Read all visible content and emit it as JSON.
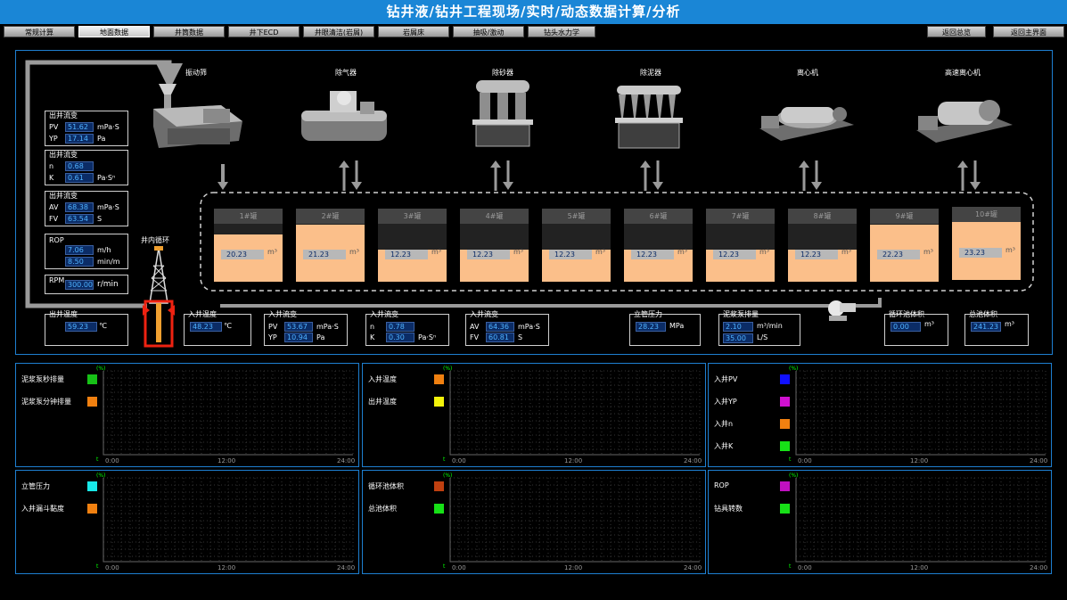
{
  "title": "钻井液/钻井工程现场/实时/动态数据计算/分析",
  "tabs": [
    {
      "label": "常规计算"
    },
    {
      "label": "地面数据"
    },
    {
      "label": "井筒数据"
    },
    {
      "label": "井下ECD"
    },
    {
      "label": "井眼清洁(岩屑)"
    },
    {
      "label": "岩屑床"
    },
    {
      "label": "抽吸/激动"
    },
    {
      "label": "钻头水力学"
    }
  ],
  "nav": {
    "back_overview": "返回总览",
    "back_main": "返回主界面"
  },
  "equipment": [
    {
      "name": "振动筛",
      "icon": "shaker-icon"
    },
    {
      "name": "除气器",
      "icon": "degasser-icon"
    },
    {
      "name": "除砂器",
      "icon": "desander-icon"
    },
    {
      "name": "除泥器",
      "icon": "desilter-icon"
    },
    {
      "name": "离心机",
      "icon": "centrifuge-icon"
    },
    {
      "name": "高速离心机",
      "icon": "high-speed-centrifuge-icon"
    }
  ],
  "tanks": [
    {
      "name": "1#罐",
      "volume": "20.23",
      "unit": "m³",
      "level": 0.82
    },
    {
      "name": "2#罐",
      "volume": "21.23",
      "unit": "m³",
      "level": 0.98
    },
    {
      "name": "3#罐",
      "volume": "12.23",
      "unit": "m³",
      "level": 0.55
    },
    {
      "name": "4#罐",
      "volume": "12.23",
      "unit": "m³",
      "level": 0.55
    },
    {
      "name": "5#罐",
      "volume": "12.23",
      "unit": "m³",
      "level": 0.55
    },
    {
      "name": "6#罐",
      "volume": "12.23",
      "unit": "m³",
      "level": 0.55
    },
    {
      "name": "7#罐",
      "volume": "12.23",
      "unit": "m³",
      "level": 0.55
    },
    {
      "name": "8#罐",
      "volume": "12.23",
      "unit": "m³",
      "level": 0.55
    },
    {
      "name": "9#罐",
      "volume": "22.23",
      "unit": "m³",
      "level": 0.98
    },
    {
      "name": "10#罐",
      "volume": "23.23",
      "unit": "m³",
      "level": 1.0
    }
  ],
  "left": {
    "rheo1": {
      "title": "出井流变",
      "pv_label": "PV",
      "pv": "51.62",
      "pv_unit": "mPa·S",
      "yp_label": "YP",
      "yp": "17.14",
      "yp_unit": "Pa"
    },
    "rheo2": {
      "title": "出井流变",
      "n_label": "n",
      "n": "0.68",
      "k_label": "K",
      "k": "0.61",
      "k_unit": "Pa·Sⁿ"
    },
    "rheo3": {
      "title": "出井流变",
      "av_label": "AV",
      "av": "68.38",
      "av_unit": "mPa·S",
      "fv_label": "FV",
      "fv": "63.54",
      "fv_unit": "S"
    },
    "rop": {
      "title": "ROP",
      "v1": "7.06",
      "u1": "m/h",
      "v2": "8.50",
      "u2": "min/m"
    },
    "rpm": {
      "label": "RPM",
      "value": "300.00",
      "unit": "r/min"
    },
    "well_label": "井内循环"
  },
  "bottom": {
    "out_temp": {
      "title": "出井温度",
      "value": "59.23",
      "unit": "℃"
    },
    "in_temp": {
      "title": "入井温度",
      "value": "48.23",
      "unit": "℃"
    },
    "in_rheo1": {
      "title": "入井流变",
      "pv_label": "PV",
      "pv": "53.67",
      "pv_unit": "mPa·S",
      "yp_label": "YP",
      "yp": "10.94",
      "yp_unit": "Pa"
    },
    "in_rheo2": {
      "title": "入井流变",
      "n_label": "n",
      "n": "0.78",
      "k_label": "K",
      "k": "0.30",
      "k_unit": "Pa·Sⁿ"
    },
    "in_rheo3": {
      "title": "入井流变",
      "av_label": "AV",
      "av": "64.36",
      "av_unit": "mPa·S",
      "fv_label": "FV",
      "fv": "60.81",
      "fv_unit": "S"
    },
    "standpipe": {
      "title": "立管压力",
      "value": "28.23",
      "unit": "MPa"
    },
    "pump": {
      "title": "泥浆泵排量",
      "v1": "2.10",
      "u1": "m³/min",
      "v2": "35.00",
      "u2": "L/S"
    },
    "circ_vol": {
      "title": "循环池体积",
      "value": "0.00",
      "unit": "m³"
    },
    "total_vol": {
      "title": "总池体积",
      "value": "241.23",
      "unit": "m³"
    }
  },
  "charts": [
    {
      "unit": "(%)",
      "legend": [
        {
          "label": "泥浆泵秒排量",
          "color": "#17c117"
        },
        {
          "label": "泥浆泵分钟排量",
          "color": "#f08010"
        }
      ],
      "ticks": [
        "0:00",
        "12:00",
        "24:00"
      ],
      "xlabel": "t"
    },
    {
      "unit": "(%)",
      "legend": [
        {
          "label": "入井温度",
          "color": "#f08010"
        },
        {
          "label": "出井温度",
          "color": "#f2f20a"
        }
      ],
      "ticks": [
        "0:00",
        "12:00",
        "24:00"
      ],
      "xlabel": "t"
    },
    {
      "unit": "(%)",
      "legend": [
        {
          "label": "入井PV",
          "color": "#1010ff"
        },
        {
          "label": "入井YP",
          "color": "#d010d0"
        },
        {
          "label": "入井n",
          "color": "#f08010"
        },
        {
          "label": "入井K",
          "color": "#17e017"
        }
      ],
      "ticks": [
        "0:00",
        "12:00",
        "24:00"
      ],
      "xlabel": "t"
    },
    {
      "unit": "(%)",
      "legend": [
        {
          "label": "立管压力",
          "color": "#18e8e8"
        },
        {
          "label": "入井漏斗黏度",
          "color": "#f08010"
        }
      ],
      "ticks": [
        "0:00",
        "12:00",
        "24:00"
      ],
      "xlabel": "t"
    },
    {
      "unit": "(%)",
      "legend": [
        {
          "label": "循环池体积",
          "color": "#c04010"
        },
        {
          "label": "总池体积",
          "color": "#17e017"
        }
      ],
      "ticks": [
        "0:00",
        "12:00",
        "24:00"
      ],
      "xlabel": "t"
    },
    {
      "unit": "(%)",
      "legend": [
        {
          "label": "ROP",
          "color": "#c010c0"
        },
        {
          "label": "钻具转数",
          "color": "#17e017"
        }
      ],
      "ticks": [
        "0:00",
        "12:00",
        "24:00"
      ],
      "xlabel": "t"
    }
  ]
}
